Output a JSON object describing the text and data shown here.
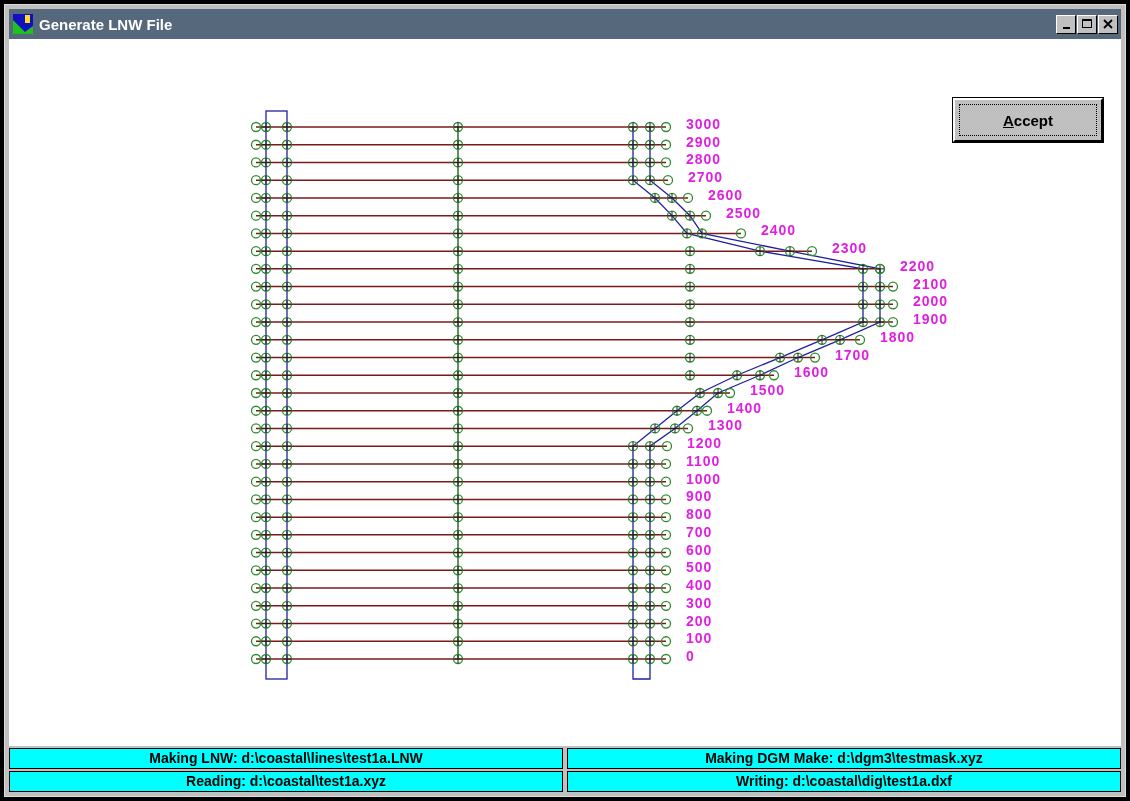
{
  "window": {
    "title": "Generate LNW File"
  },
  "accept_button": {
    "label": "Accept"
  },
  "plot": {
    "lines": [
      {
        "label": "3000"
      },
      {
        "label": "2900"
      },
      {
        "label": "2800"
      },
      {
        "label": "2700"
      },
      {
        "label": "2600"
      },
      {
        "label": "2500"
      },
      {
        "label": "2400"
      },
      {
        "label": "2300"
      },
      {
        "label": "2200"
      },
      {
        "label": "2100"
      },
      {
        "label": "2000"
      },
      {
        "label": "1900"
      },
      {
        "label": "1800"
      },
      {
        "label": "1700"
      },
      {
        "label": "1600"
      },
      {
        "label": "1500"
      },
      {
        "label": "1400"
      },
      {
        "label": "1300"
      },
      {
        "label": "1200"
      },
      {
        "label": "1100"
      },
      {
        "label": "1000"
      },
      {
        "label": "900"
      },
      {
        "label": "800"
      },
      {
        "label": "700"
      },
      {
        "label": "600"
      },
      {
        "label": "500"
      },
      {
        "label": "400"
      },
      {
        "label": "300"
      },
      {
        "label": "200"
      },
      {
        "label": "100"
      },
      {
        "label": "0"
      }
    ]
  },
  "status_bar": {
    "rows": [
      [
        {
          "text": "Making LNW: d:\\coastal\\lines\\test1a.LNW"
        },
        {
          "text": "Making DGM Make: d:\\dgm3\\testmask.xyz"
        }
      ],
      [
        {
          "text": "Reading: d:\\coastal\\test1a.xyz"
        },
        {
          "text": "Writing: d:\\coastal\\dig\\test1a.dxf"
        }
      ]
    ]
  }
}
